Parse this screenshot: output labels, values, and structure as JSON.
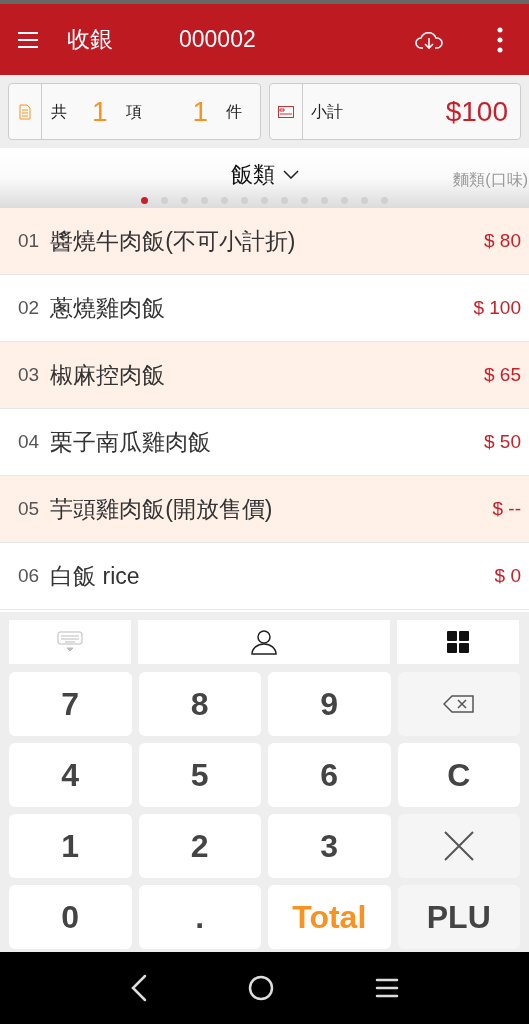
{
  "header": {
    "title": "收銀",
    "order_number": "000002"
  },
  "summary": {
    "total_label": "共",
    "items_count": "1",
    "items_label": "項",
    "pieces_count": "1",
    "pieces_label": "件",
    "subtotal_label": "小計",
    "subtotal": "$100"
  },
  "category": {
    "current": "飯類",
    "next": "麵類(口味)",
    "pages": [
      {
        "selected": true
      },
      {
        "selected": false
      },
      {
        "selected": false
      },
      {
        "selected": false
      },
      {
        "selected": false
      },
      {
        "selected": false
      },
      {
        "selected": false
      },
      {
        "selected": false
      },
      {
        "selected": false
      },
      {
        "selected": false
      },
      {
        "selected": false
      },
      {
        "selected": false
      },
      {
        "selected": false
      }
    ]
  },
  "products": [
    {
      "code": "01",
      "name": "醬燒牛肉飯(不可小計折)",
      "price": "$ 80"
    },
    {
      "code": "02",
      "name": "蔥燒雞肉飯",
      "price": "$ 100"
    },
    {
      "code": "03",
      "name": "椒麻控肉飯",
      "price": "$ 65"
    },
    {
      "code": "04",
      "name": "栗子南瓜雞肉飯",
      "price": "$ 50"
    },
    {
      "code": "05",
      "name": "芋頭雞肉飯(開放售價)",
      "price": "$ --"
    },
    {
      "code": "06",
      "name": "白飯 rice",
      "price": "$ 0"
    }
  ],
  "keypad": [
    {
      "kind": "digit",
      "label": "7"
    },
    {
      "kind": "digit",
      "label": "8"
    },
    {
      "kind": "digit",
      "label": "9"
    },
    {
      "kind": "backspace"
    },
    {
      "kind": "digit",
      "label": "4"
    },
    {
      "kind": "digit",
      "label": "5"
    },
    {
      "kind": "digit",
      "label": "6"
    },
    {
      "kind": "digit",
      "label": "C"
    },
    {
      "kind": "digit",
      "label": "1"
    },
    {
      "kind": "digit",
      "label": "2"
    },
    {
      "kind": "digit",
      "label": "3"
    },
    {
      "kind": "multiply"
    },
    {
      "kind": "digit",
      "label": "0"
    },
    {
      "kind": "digit",
      "label": "."
    },
    {
      "kind": "total",
      "label": "Total"
    },
    {
      "kind": "plu",
      "label": "PLU"
    }
  ]
}
